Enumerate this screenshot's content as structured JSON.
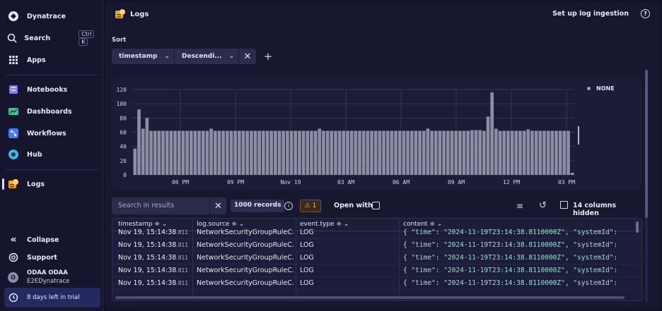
{
  "sidebar": {
    "brand": "Dynatrace",
    "search": {
      "label": "Search",
      "shortcut": [
        "Ctrl",
        "K"
      ]
    },
    "apps": "Apps",
    "items": [
      {
        "label": "Notebooks",
        "icon": "notebooks-icon",
        "color": "#8b7cf6"
      },
      {
        "label": "Dashboards",
        "icon": "dashboards-icon",
        "color": "#3fc28f"
      },
      {
        "label": "Workflows",
        "icon": "workflows-icon",
        "color": "#4b7bff"
      },
      {
        "label": "Hub",
        "icon": "hub-icon",
        "color": "#3fb6e8"
      },
      {
        "label": "Logs",
        "icon": "logs-icon",
        "color": "#f5a623"
      }
    ],
    "collapse": "Collapse",
    "support": "Support",
    "user": {
      "name": "ODAA ODAA",
      "org": "E2EDynatrace",
      "initial": "O"
    },
    "trial": "8 days left in trial"
  },
  "header": {
    "title": "Logs",
    "setup_link": "Set up log ingestion",
    "help": "?"
  },
  "sort": {
    "label": "Sort",
    "field": "timestamp",
    "order": "Descendi...",
    "plus": "+"
  },
  "chart_data": {
    "type": "bar",
    "y_ticks": [
      "120",
      "100",
      "80",
      "60",
      "40",
      "20",
      "0"
    ],
    "ylim": [
      0,
      120
    ],
    "x_tick_labels": [
      "06 PM",
      "09 PM",
      "Nov 19",
      "03 AM",
      "06 AM",
      "09 AM",
      "12 PM",
      "03 PM"
    ],
    "series": [
      {
        "name": "NONE",
        "values": [
          37,
          92,
          65,
          80,
          62,
          62,
          62,
          62,
          62,
          62,
          62,
          62,
          62,
          62,
          62,
          62,
          62,
          62,
          62,
          65,
          62,
          62,
          62,
          62,
          62,
          62,
          62,
          62,
          62,
          62,
          62,
          62,
          62,
          62,
          62,
          62,
          62,
          62,
          62,
          62,
          62,
          62,
          62,
          62,
          62,
          62,
          65,
          62,
          62,
          62,
          62,
          62,
          62,
          62,
          62,
          62,
          62,
          62,
          62,
          62,
          62,
          62,
          62,
          62,
          62,
          62,
          62,
          62,
          62,
          62,
          62,
          62,
          62,
          65,
          62,
          62,
          62,
          62,
          62,
          62,
          62,
          62,
          62,
          62,
          63,
          63,
          63,
          62,
          82,
          116,
          65,
          62,
          62,
          62,
          62,
          62,
          62,
          62,
          64,
          62,
          62,
          62,
          62,
          62,
          62,
          62,
          62,
          62,
          62,
          3
        ]
      }
    ],
    "bar_color": "#8c8ea6",
    "legend": "top-right",
    "grid": true
  },
  "results": {
    "search_placeholder": "Search in results",
    "records": "1000 records",
    "warnings": "1",
    "open_with": "Open with",
    "columns_hidden": "14 columns hidden"
  },
  "table": {
    "columns": [
      "timestamp ≑ ⌄",
      "log.source ≑ ⌄",
      "event.type ≑ ⌄",
      "content ≑ ⌄"
    ],
    "rows": [
      {
        "ts": "Nov 19, 15:14:38",
        "ms": ".811",
        "source": "NetworkSecurityGroupRuleC...",
        "type": "LOG",
        "c1": "{ ",
        "c2": "\"time\"",
        "c3": ": ",
        "c4": "\"2024-11-19T23:14:38.8110000Z\"",
        "c5": ", ",
        "c6": "\"systemId\"",
        "c7": ":"
      },
      {
        "ts": "Nov 19, 15:14:38",
        "ms": ".811",
        "source": "NetworkSecurityGroupRuleC...",
        "type": "LOG",
        "c1": "{ ",
        "c2": "\"time\"",
        "c3": ": ",
        "c4": "\"2024-11-19T23:14:38.8110000Z\"",
        "c5": ", ",
        "c6": "\"systemId\"",
        "c7": ":"
      },
      {
        "ts": "Nov 19, 15:14:38",
        "ms": ".811",
        "source": "NetworkSecurityGroupRuleC...",
        "type": "LOG",
        "c1": "{ ",
        "c2": "\"time\"",
        "c3": ": ",
        "c4": "\"2024-11-19T23:14:38.8110000Z\"",
        "c5": ", ",
        "c6": "\"systemId\"",
        "c7": ":"
      },
      {
        "ts": "Nov 19, 15:14:38",
        "ms": ".811",
        "source": "NetworkSecurityGroupRuleC...",
        "type": "LOG",
        "c1": "{ ",
        "c2": "\"time\"",
        "c3": ": ",
        "c4": "\"2024-11-19T23:14:38.8110000Z\"",
        "c5": ", ",
        "c6": "\"systemId\"",
        "c7": ":"
      },
      {
        "ts": "Nov 19, 15:14:38",
        "ms": ".811",
        "source": "NetworkSecurityGroupRuleC...",
        "type": "LOG",
        "c1": "{ ",
        "c2": "\"time\"",
        "c3": ": ",
        "c4": "\"2024-11-19T23:14:38.8110000Z\"",
        "c5": ", ",
        "c6": "\"systemId\"",
        "c7": ":"
      }
    ]
  }
}
